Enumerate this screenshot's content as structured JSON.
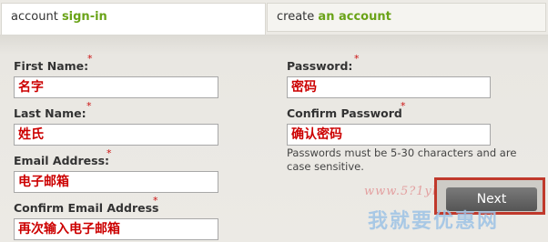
{
  "tabs": [
    {
      "word1": "account",
      "word2": "sign-in"
    },
    {
      "word1": "create",
      "word2": "an account"
    }
  ],
  "left_fields": [
    {
      "label": "First Name:",
      "required_mark": "*",
      "value": "名字"
    },
    {
      "label": "Last Name:",
      "required_mark": "*",
      "value": "姓氏"
    },
    {
      "label": "Email Address:",
      "required_mark": "*",
      "value": "电子邮箱"
    },
    {
      "label": "Confirm Email Address",
      "required_mark": "*",
      "value": "再次输入电子邮箱"
    }
  ],
  "right_fields": [
    {
      "label": "Password:",
      "required_mark": "*",
      "value": "密码"
    },
    {
      "label": "Confirm Password",
      "required_mark": "*",
      "value": "确认密码"
    }
  ],
  "password_help": "Passwords must be 5-30 characters and are case sensitive.",
  "next_button": {
    "label": "Next"
  },
  "watermark": {
    "url": "www.5?1yhw.com",
    "text": "我就要优惠网"
  },
  "colors": {
    "accent_green": "#6aa318",
    "required_red": "#cc1111",
    "value_red": "#cc0000",
    "highlight_box": "#c0392b"
  }
}
